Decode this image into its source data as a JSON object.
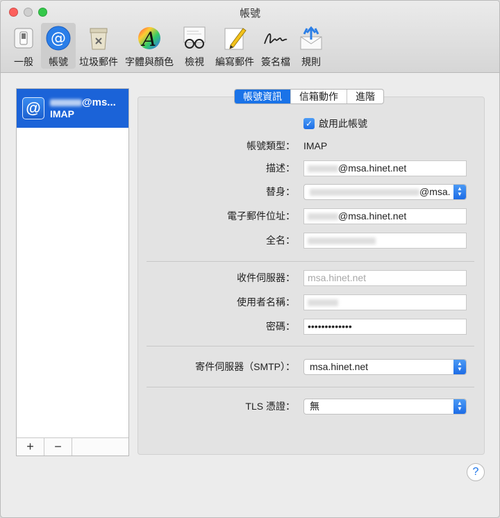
{
  "window": {
    "title": "帳號"
  },
  "toolbar": {
    "items": [
      {
        "label": "一般",
        "icon": "switch-icon"
      },
      {
        "label": "帳號",
        "icon": "at-sign-icon",
        "selected": true
      },
      {
        "label": "垃圾郵件",
        "icon": "trash-bin-icon"
      },
      {
        "label": "字體與顏色",
        "icon": "font-color-icon"
      },
      {
        "label": "檢視",
        "icon": "glasses-icon"
      },
      {
        "label": "編寫郵件",
        "icon": "pencil-icon"
      },
      {
        "label": "簽名檔",
        "icon": "signature-icon"
      },
      {
        "label": "規則",
        "icon": "rules-icon"
      }
    ]
  },
  "accounts": {
    "items": [
      {
        "name": "@ms...",
        "type": "IMAP",
        "icon": "at-sign-icon"
      }
    ],
    "add_label": "+",
    "remove_label": "−"
  },
  "tabs": {
    "account_info": "帳號資訊",
    "mailbox_behaviors": "信箱動作",
    "advanced": "進階"
  },
  "form": {
    "enable_label": "啟用此帳號",
    "enable_checked": true,
    "account_type_label": "帳號類型：",
    "account_type_value": "IMAP",
    "description_label": "描述：",
    "description_value": "@msa.hinet.net",
    "alias_label": "替身：",
    "alias_value": "@msa.",
    "email_label": "電子郵件位址：",
    "email_value": "@msa.hinet.net",
    "full_name_label": "全名：",
    "incoming_server_label": "收件伺服器：",
    "incoming_server_value": "msa.hinet.net",
    "username_label": "使用者名稱：",
    "password_label": "密碼：",
    "password_value": "•••••••••••••",
    "outgoing_server_label": "寄件伺服器（SMTP）：",
    "outgoing_server_value": "msa.hinet.net",
    "tls_label": "TLS 憑證：",
    "tls_value": "無"
  },
  "help_label": "?",
  "colors": {
    "accent": "#1a73e8",
    "selection": "#1b63d8"
  }
}
